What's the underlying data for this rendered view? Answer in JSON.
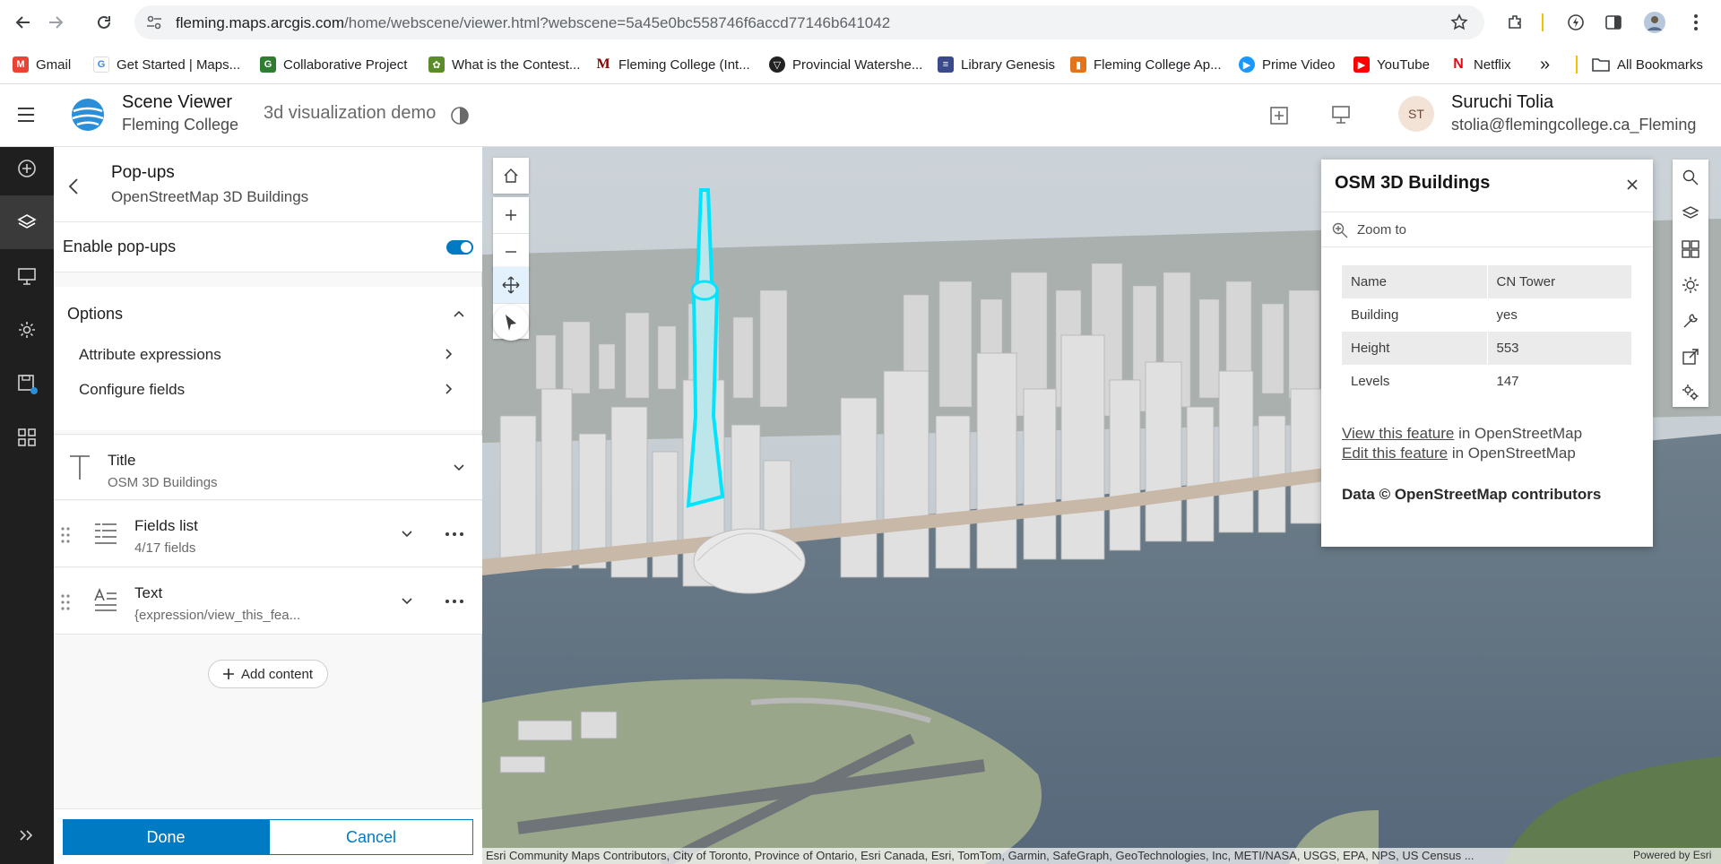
{
  "browser": {
    "url_host": "fleming.maps.arcgis.com",
    "url_path": "/home/webscene/viewer.html?webscene=5a45e0bc558746f6accd77146b641042",
    "bookmarks": [
      {
        "label": "Gmail",
        "icon": "gmail-icon",
        "color": "#ea4335"
      },
      {
        "label": "Get Started | Maps...",
        "icon": "google-icon",
        "color": "#4285f4"
      },
      {
        "label": "Collaborative Project",
        "icon": "gis-icon",
        "color": "#2e7d32"
      },
      {
        "label": "What is the Contest...",
        "icon": "plant-icon",
        "color": "#5b8c2a"
      },
      {
        "label": "Fleming College (Int...",
        "icon": "fleming-m-icon",
        "color": "#8b0000"
      },
      {
        "label": "Provincial Watershe...",
        "icon": "provincial-icon",
        "color": "#222222"
      },
      {
        "label": "Library Genesis",
        "icon": "library-icon",
        "color": "#3b4a8a"
      },
      {
        "label": "Fleming College Ap...",
        "icon": "bars-icon",
        "color": "#e5731a"
      },
      {
        "label": "Prime Video",
        "icon": "prime-video-icon",
        "color": "#1a98ff"
      },
      {
        "label": "YouTube",
        "icon": "youtube-icon",
        "color": "#ff0000"
      },
      {
        "label": "Netflix",
        "icon": "netflix-icon",
        "color": "#e50914"
      }
    ],
    "more_label": "»",
    "all_bookmarks_label": "All Bookmarks"
  },
  "header": {
    "app_title": "Scene Viewer",
    "org": "Fleming College",
    "scene_name": "3d visualization demo",
    "user_initials": "ST",
    "user_name": "Suruchi Tolia",
    "user_email": "stolia@flemingcollege.ca_Fleming"
  },
  "panel": {
    "title": "Pop-ups",
    "subtitle": "OpenStreetMap 3D Buildings",
    "enable_label": "Enable pop-ups",
    "enable_on": true,
    "options_label": "Options",
    "options_items": [
      "Attribute expressions",
      "Configure fields"
    ],
    "title_block": {
      "label": "Title",
      "value": "OSM 3D Buildings"
    },
    "content_blocks": [
      {
        "label": "Fields list",
        "sub": "4/17 fields",
        "icon": "fields-list-icon"
      },
      {
        "label": "Text",
        "sub": "{expression/view_this_fea...",
        "icon": "text-icon"
      }
    ],
    "add_content_label": "Add content",
    "done_label": "Done",
    "cancel_label": "Cancel"
  },
  "popup": {
    "title": "OSM 3D Buildings",
    "zoom_label": "Zoom to",
    "fields": [
      {
        "name": "Name",
        "value": "CN Tower"
      },
      {
        "name": "Building",
        "value": "yes"
      },
      {
        "name": "Height",
        "value": "553"
      },
      {
        "name": "Levels",
        "value": "147"
      }
    ],
    "link1": "View this feature",
    "link1_suffix": " in OpenStreetMap",
    "link2": "Edit this feature",
    "link2_suffix": " in OpenStreetMap",
    "data_credit": "Data © OpenStreetMap contributors"
  },
  "map": {
    "attribution": "Esri Community Maps Contributors, City of Toronto, Province of Ontario, Esri Canada, Esri, TomTom, Garmin, SafeGraph, GeoTechnologies, Inc, METI/NASA, USGS, EPA, NPS, US Census ...",
    "powered_by": "Powered by Esri"
  },
  "colors": {
    "accent": "#007ac2",
    "highlight": "#00e5ff",
    "water": "#5e6f7c",
    "nav_dark": "#1f1f1f"
  }
}
